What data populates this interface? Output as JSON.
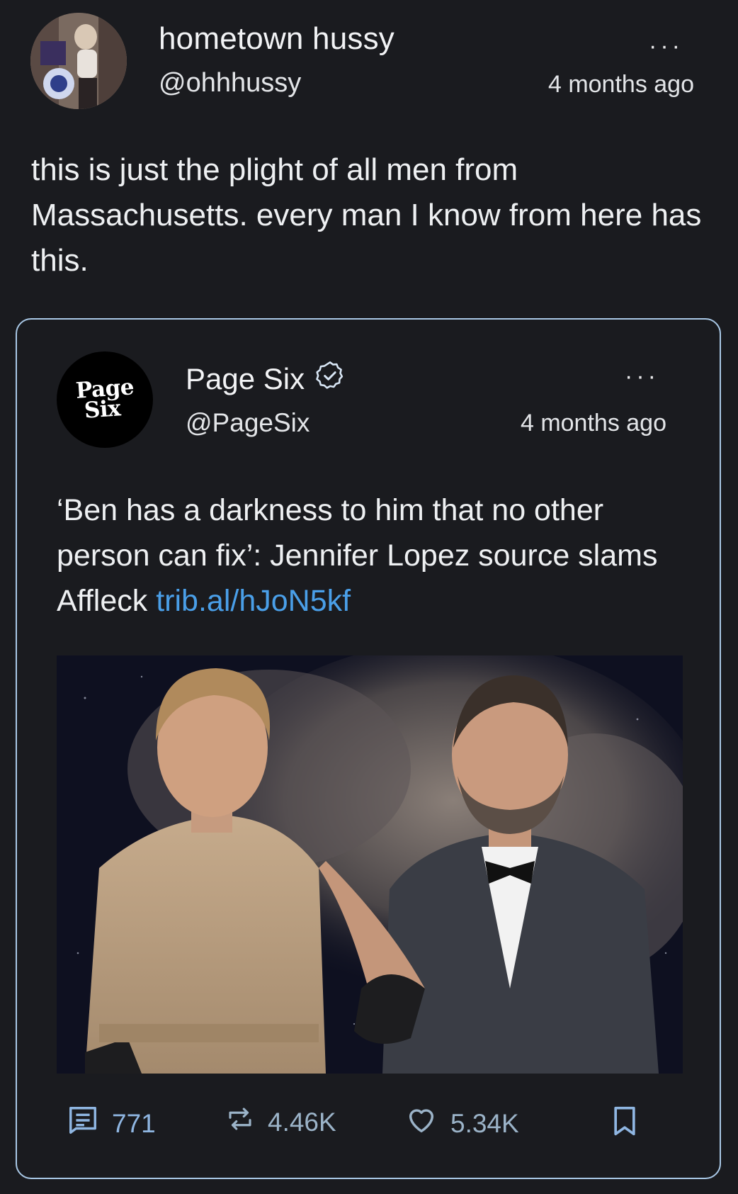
{
  "post": {
    "display_name": "hometown hussy",
    "handle": "@ohhhussy",
    "timestamp": "4 months ago",
    "text": "this is just the plight of all men from Massachusetts. every man I know from here has this.",
    "more_icon": "ellipsis-icon"
  },
  "quoted": {
    "display_name": "Page Six",
    "verified_icon": "verified-badge-icon",
    "handle": "@PageSix",
    "timestamp": "4 months ago",
    "avatar_text_line1": "Page",
    "avatar_text_line2": "Six",
    "text": "‘Ben has a darkness to him that no other person can fix’: Jennifer Lopez source slams Affleck ",
    "link": "trib.al/hJoN5kf"
  },
  "actions": {
    "replies": "771",
    "reposts": "4.46K",
    "likes": "5.34K"
  },
  "colors": {
    "background": "#1a1b1f",
    "card_border": "#a9c8e6",
    "link": "#4a9fe8"
  }
}
